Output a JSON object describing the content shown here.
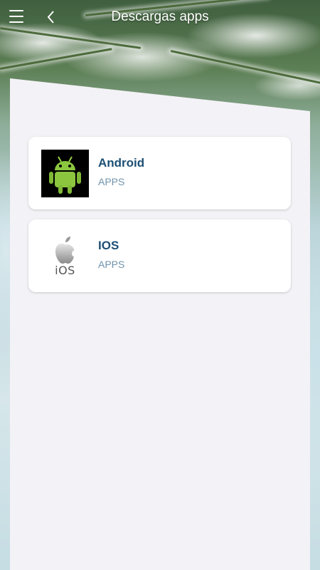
{
  "header": {
    "title": "Descargas apps",
    "menu_icon": "hamburger-menu-icon",
    "back_icon": "chevron-left-icon"
  },
  "items": [
    {
      "name": "Android",
      "subtitle": "APPS",
      "icon": "android-logo"
    },
    {
      "name": "IOS",
      "subtitle": "APPS",
      "icon": "apple-ios-logo",
      "icon_text": "iOS"
    }
  ],
  "colors": {
    "title_text": "#1d4f74",
    "subtitle_text": "#6f93ab",
    "panel_bg": "#f3f2f6",
    "card_bg": "#ffffff",
    "android_green": "#8cc63f"
  }
}
